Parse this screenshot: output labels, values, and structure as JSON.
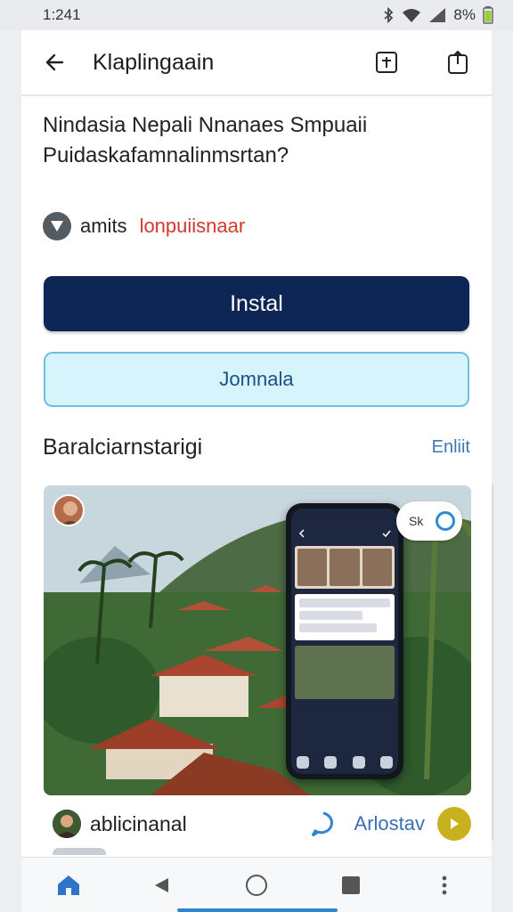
{
  "status_bar": {
    "time": "1:241",
    "battery": "8%",
    "icons": [
      "bluetooth-icon",
      "wifi-icon",
      "signal-icon",
      "battery-icon"
    ]
  },
  "app_bar": {
    "title": "Klaplingaain",
    "icons": [
      "back-arrow-icon",
      "add-square-icon",
      "share-icon"
    ]
  },
  "heading": {
    "line1": "Nindasia Nepali Nnanaes Smpuaii",
    "line2": "Puidaskafamnalinmsrtan?"
  },
  "meta": {
    "author": "amits",
    "category": "lonpuiisnaar"
  },
  "buttons": {
    "install": "Instal",
    "secondary": "Jomnala"
  },
  "section": {
    "title": "Baralciarnstarigi",
    "link": "Enliit"
  },
  "media": {
    "chip_label": "Sk"
  },
  "post": {
    "author": "ablicinanal",
    "action": "Arlostav"
  },
  "colors": {
    "primary": "#0e2656",
    "accent": "#2f84d3",
    "category": "#d23a2c",
    "secondary_bg": "#d5f4fb"
  },
  "bottom_nav": {
    "items": [
      "home-icon",
      "back-triangle-icon",
      "circle-home-icon",
      "square-recents-icon",
      "more-vertical-icon"
    ]
  }
}
